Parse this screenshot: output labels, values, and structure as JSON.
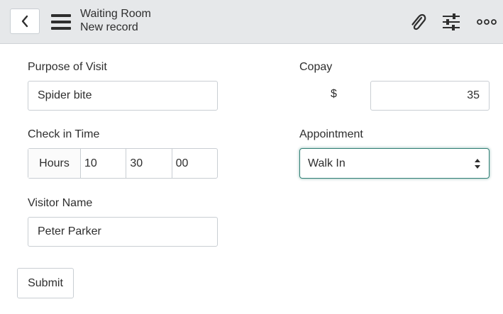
{
  "header": {
    "title": "Waiting Room",
    "subtitle": "New record",
    "icons": [
      "chevron-left-icon",
      "hamburger-menu-icon",
      "paperclip-icon",
      "sliders-icon",
      "more-icon"
    ]
  },
  "form": {
    "purpose": {
      "label": "Purpose of Visit",
      "value": "Spider bite"
    },
    "copay": {
      "label": "Copay",
      "currency": "$",
      "value": "35"
    },
    "checkin": {
      "label": "Check in Time",
      "prefix": "Hours",
      "hours": "10",
      "minutes": "30",
      "seconds": "00"
    },
    "appointment": {
      "label": "Appointment",
      "value": "Walk In"
    },
    "visitor": {
      "label": "Visitor Name",
      "value": "Peter Parker"
    },
    "submit_label": "Submit"
  },
  "colors": {
    "header_bg": "#e6e8ea",
    "focus_border": "#2f7f74"
  }
}
